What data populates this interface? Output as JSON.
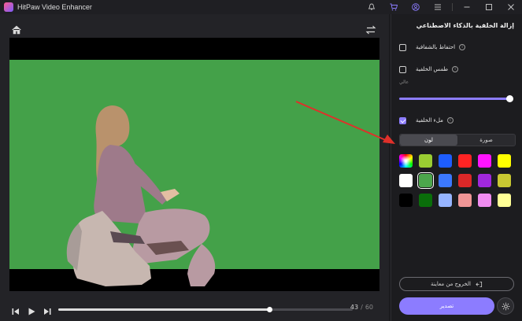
{
  "app": {
    "title": "HitPaw Video Enhancer",
    "accent": "#8c7cff"
  },
  "titlebar": {
    "icons": [
      "bell-icon",
      "cart-icon",
      "user-icon",
      "menu-icon",
      "minimize-icon",
      "maximize-icon",
      "close-icon"
    ]
  },
  "player": {
    "current_time": "43",
    "separator": "/",
    "total_time": "60",
    "progress_fraction": 0.716,
    "green_screen_color": "#44a149"
  },
  "panel": {
    "title": "إزالة الخلفية بالذكاء الاصطناعي",
    "options": [
      {
        "label": "احتفاظ بالشفافية",
        "checked": false
      },
      {
        "label": "طمس الخلفية",
        "checked": false
      },
      {
        "label": "ملء الخلفية",
        "checked": true
      }
    ],
    "strength_label": "عالي",
    "strength_fraction": 1.0,
    "tabs": [
      {
        "label": "لون",
        "active": true
      },
      {
        "label": "صورة",
        "active": false
      }
    ],
    "swatches": [
      "gradient",
      "#9acd32",
      "#1e5dff",
      "#ff2424",
      "#ff14ff",
      "#ffff00",
      "#ffffff",
      "#4ca64c",
      "#3c78ff",
      "#dc2828",
      "#a028dc",
      "#c8c832",
      "#000000",
      "#0a6e0a",
      "#96b4ff",
      "#f09696",
      "#f08cf0",
      "#ffff96"
    ],
    "selected_swatch": 7,
    "exit_label": "الخروج من معاينة",
    "export_label": "تصدير"
  }
}
